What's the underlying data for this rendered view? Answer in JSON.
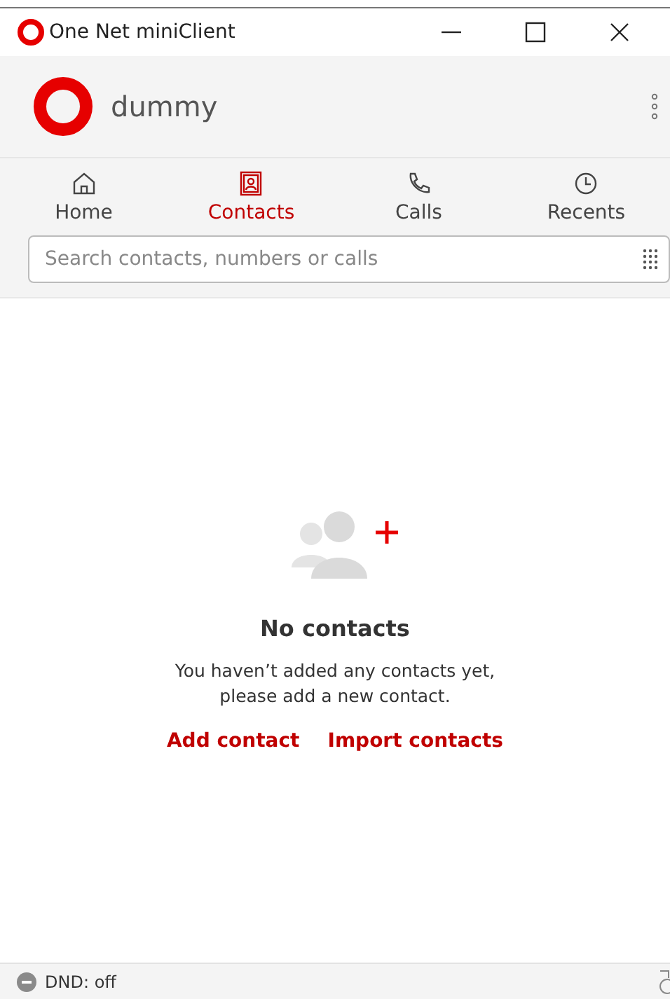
{
  "window": {
    "title": "One Net miniClient"
  },
  "header": {
    "user": "dummy"
  },
  "tabs": [
    {
      "label": "Home",
      "kind": "home",
      "selected": false
    },
    {
      "label": "Contacts",
      "kind": "contacts",
      "selected": true
    },
    {
      "label": "Calls",
      "kind": "calls",
      "selected": false
    },
    {
      "label": "Recents",
      "kind": "recents",
      "selected": false
    }
  ],
  "search": {
    "placeholder": "Search contacts, numbers or calls"
  },
  "empty_state": {
    "title": "No contacts",
    "message": "You haven’t added any contacts yet, please add a new contact.",
    "actions": [
      "Add contact",
      "Import contacts"
    ]
  },
  "status_bar": {
    "dnd": "DND: off"
  }
}
